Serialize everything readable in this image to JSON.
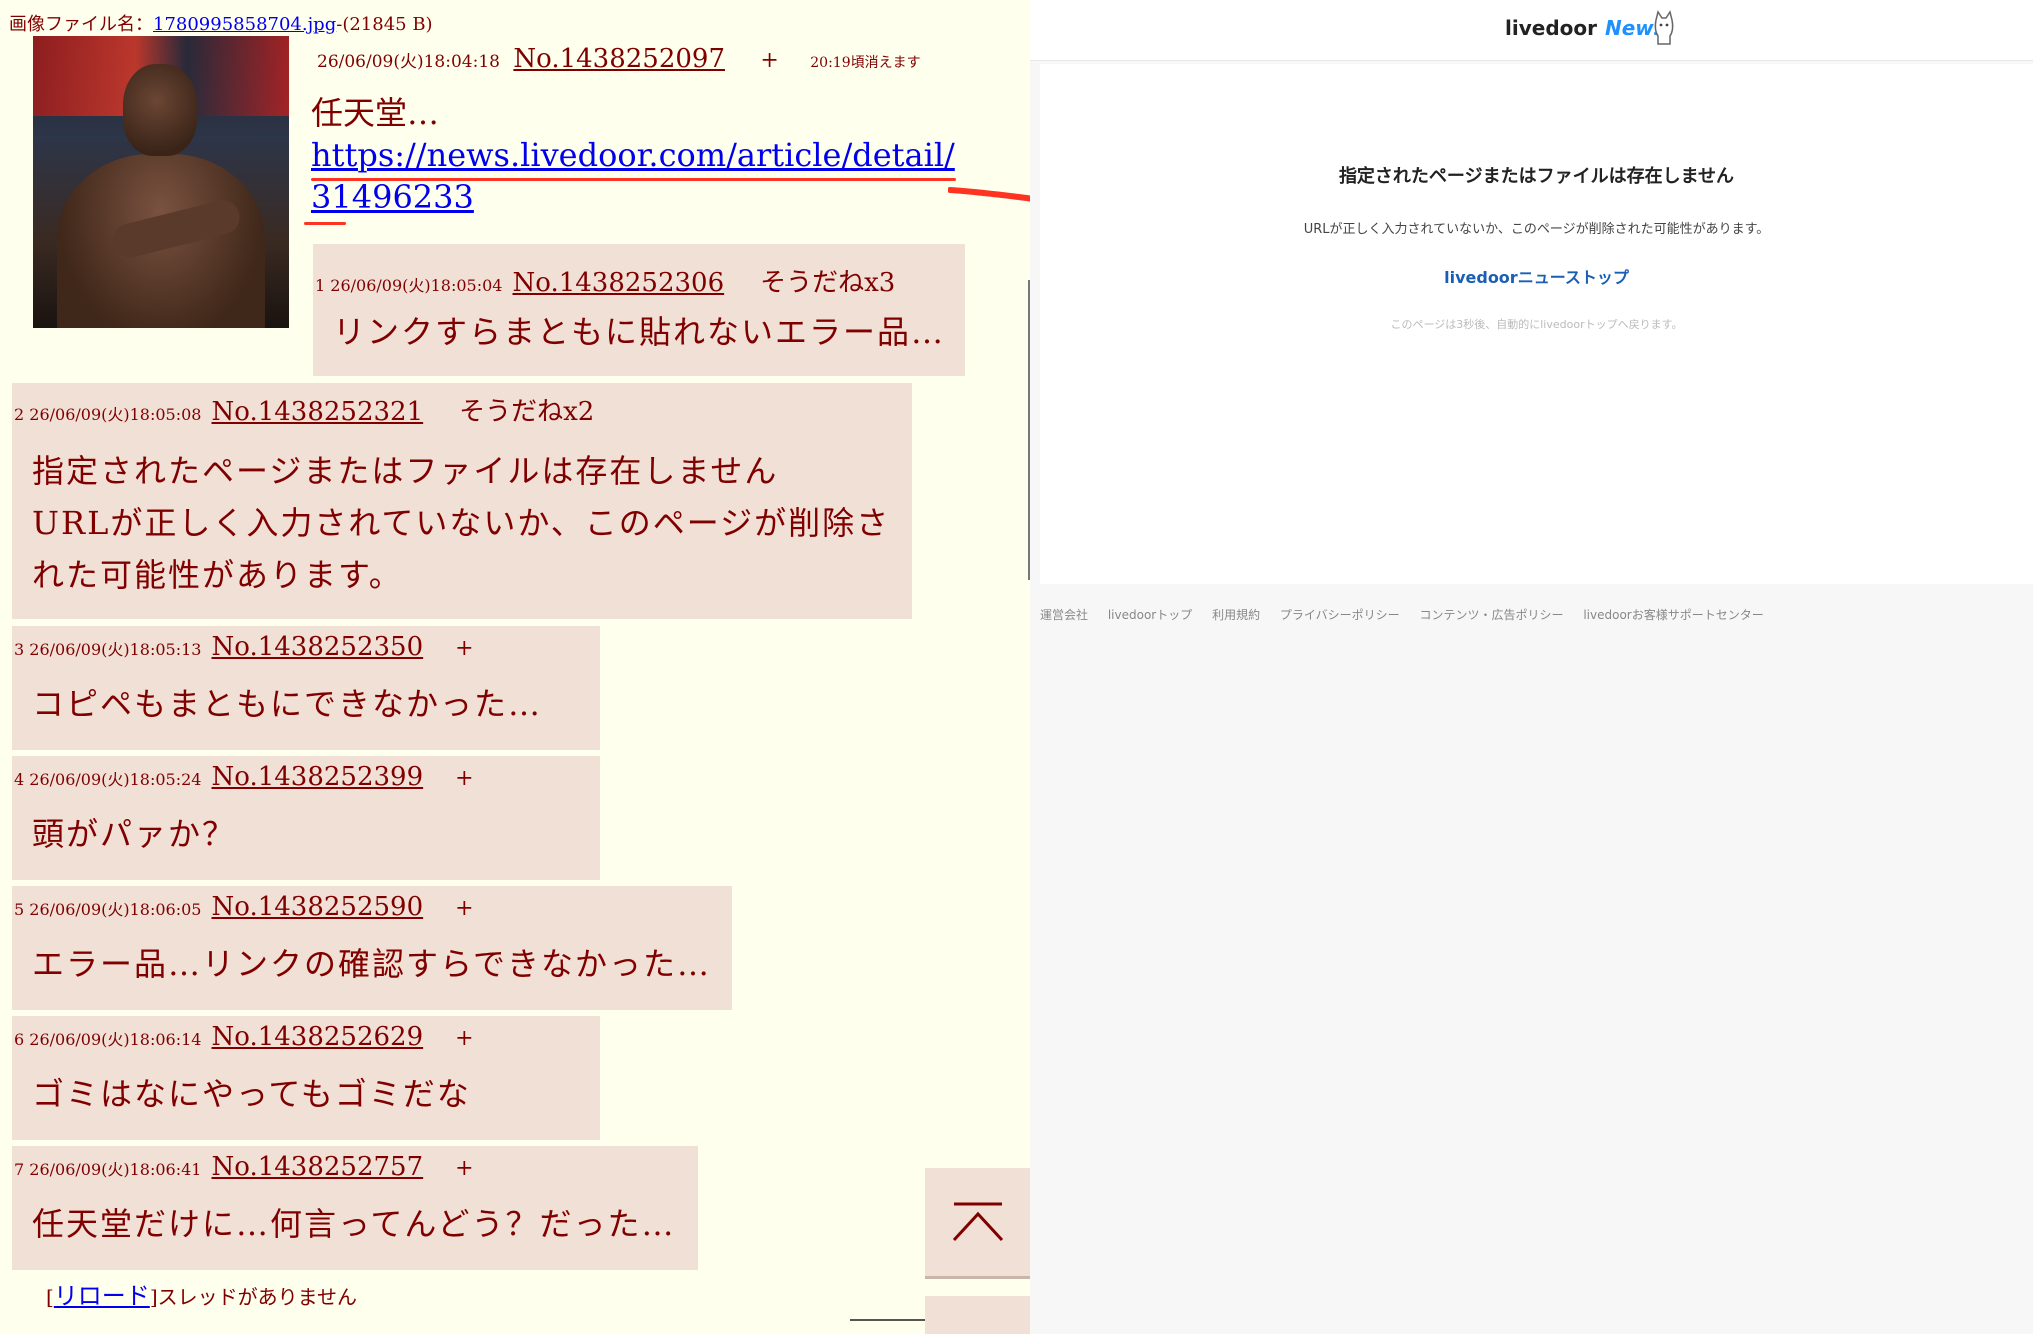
{
  "thread": {
    "filename_label": "画像ファイル名：",
    "filename_link": "1780995858704.jpg",
    "filename_size": "-(21845 B)",
    "op": {
      "date": "26/06/09(火)18:04:18",
      "no": "No.1438252097",
      "plus": "+",
      "expire": "20:19頃消えます",
      "text": "任天堂…",
      "link": "https://news.livedoor.com/article/detail/31496233"
    },
    "replies": [
      {
        "index": "1",
        "date": "26/06/09(火)18:05:04",
        "no": "No.1438252306",
        "extra": "そうだねx3",
        "text": [
          "リンクすらまともに貼れないエラー品…"
        ]
      },
      {
        "index": "2",
        "date": "26/06/09(火)18:05:08",
        "no": "No.1438252321",
        "extra": "そうだねx2",
        "text": [
          "指定されたページまたはファイルは存在しません",
          "URLが正しく入力されていないか、このページが削除さ",
          "れた可能性があります。"
        ]
      },
      {
        "index": "3",
        "date": "26/06/09(火)18:05:13",
        "no": "No.1438252350",
        "extra": "+",
        "text": [
          "コピペもまともにできなかった…"
        ]
      },
      {
        "index": "4",
        "date": "26/06/09(火)18:05:24",
        "no": "No.1438252399",
        "extra": "+",
        "text": [
          "頭がパァか？"
        ]
      },
      {
        "index": "5",
        "date": "26/06/09(火)18:06:05",
        "no": "No.1438252590",
        "extra": "+",
        "text": [
          "エラー品…リンクの確認すらできなかった…"
        ]
      },
      {
        "index": "6",
        "date": "26/06/09(火)18:06:14",
        "no": "No.1438252629",
        "extra": "+",
        "text": [
          "ゴミはなにやってもゴミだな"
        ]
      },
      {
        "index": "7",
        "date": "26/06/09(火)18:06:41",
        "no": "No.1438252757",
        "extra": "+",
        "text": [
          "任天堂だけに…何言ってんどう？だった…"
        ]
      }
    ],
    "reload_link": "リロード",
    "reload_suffix": "スレッドがありません"
  },
  "livedoor": {
    "logo_brand": "livedoor",
    "logo_news": "News",
    "title": "指定されたページまたはファイルは存在しません",
    "description": "URLが正しく入力されていないか、このページが削除された可能性があります。",
    "top_link": "livedoorニューストップ",
    "note": "このページは3秒後、自動的にlivedoorトップへ戻ります。",
    "footer": [
      "運営会社",
      "livedoorトップ",
      "利用規約",
      "プライバシーポリシー",
      "コンテンツ・広告ポリシー",
      "livedoorお客様サポートセンター"
    ]
  },
  "colors": {
    "thread_bg": "#ffffee",
    "reply_bg": "#f0e0d6",
    "text": "#800000",
    "link": "#0000ee",
    "annotation": "#ff3322",
    "ld_link": "#1a5fb4"
  }
}
